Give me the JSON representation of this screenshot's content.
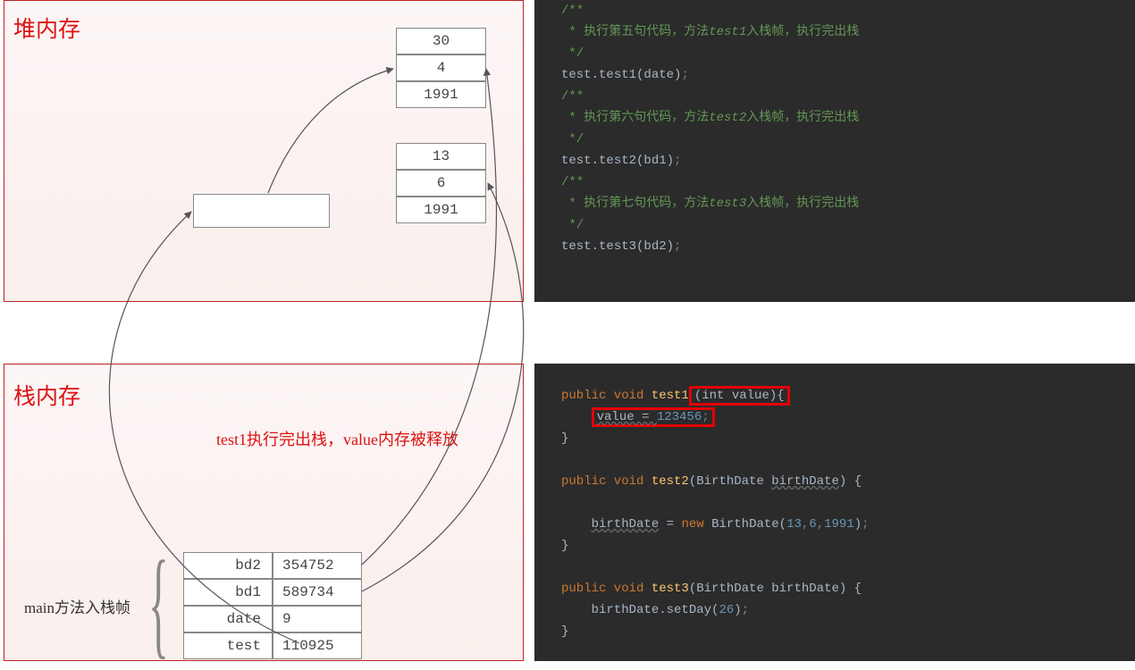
{
  "heap": {
    "title": "堆内存",
    "obj1": [
      "30",
      "4",
      "1991"
    ],
    "obj2": [
      "13",
      "6",
      "1991"
    ],
    "emptyBox": ""
  },
  "stack": {
    "title": "栈内存",
    "annotation": "test1执行完出栈，value内存被释放",
    "mainLabel": "main方法入栈帧",
    "rows": [
      {
        "name": "bd2",
        "val": "354752"
      },
      {
        "name": "bd1",
        "val": "589734"
      },
      {
        "name": "date",
        "val": "9"
      },
      {
        "name": "test",
        "val": "110925"
      }
    ]
  },
  "codeTop": {
    "c1_open": "/**",
    "c1_body": " * 执行第五句代码，方法",
    "c1_kw": "test1",
    "c1_tail": "入栈帧，执行完出栈",
    "c1_close": " */",
    "l1_a": "test.",
    "l1_b": "test1",
    "l1_c": "(date)",
    "l1_d": ";",
    "c2_open": "/**",
    "c2_body": " * 执行第六句代码，方法",
    "c2_kw": "test2",
    "c2_tail": "入栈帧，执行完出栈",
    "c2_close": " */",
    "l2_a": "test.",
    "l2_b": "test2",
    "l2_c": "(bd1)",
    "l2_d": ";",
    "c3_open": "/**",
    "c3_body": " * 执行第七句代码，方法",
    "c3_kw": "test3",
    "c3_tail": "入栈帧，执行完出栈",
    "c3_close": " */",
    "l3_a": "test.",
    "l3_b": "test3",
    "l3_c": "(bd2)",
    "l3_d": ";"
  },
  "codeBottom": {
    "m1_kw": "public void",
    "m1_name": " test1",
    "m1_sig": "(int value)",
    "m1_brace": "{",
    "m1_body_a": "value = ",
    "m1_body_num": "123456",
    "m1_body_semi": ";",
    "m1_close": "}",
    "m2_kw": "public void",
    "m2_name": " test2",
    "m2_sig": "(BirthDate ",
    "m2_param": "birthDate",
    "m2_sig2": ") {",
    "m2_body_lhs": "birthDate",
    "m2_body_eq": " = ",
    "m2_body_new": "new ",
    "m2_body_cls": "BirthDate(",
    "m2_n1": "13",
    "m2_comma1": ",",
    "m2_n2": "6",
    "m2_comma2": ",",
    "m2_n3": "1991",
    "m2_body_end": ")",
    "m2_semi": ";",
    "m2_close": "}",
    "m3_kw": "public void",
    "m3_name": " test3",
    "m3_sig": "(BirthDate birthDate) {",
    "m3_body_a": "birthDate.",
    "m3_body_b": "setDay",
    "m3_body_c": "(",
    "m3_body_num": "26",
    "m3_body_d": ")",
    "m3_semi": ";",
    "m3_close": "}"
  }
}
